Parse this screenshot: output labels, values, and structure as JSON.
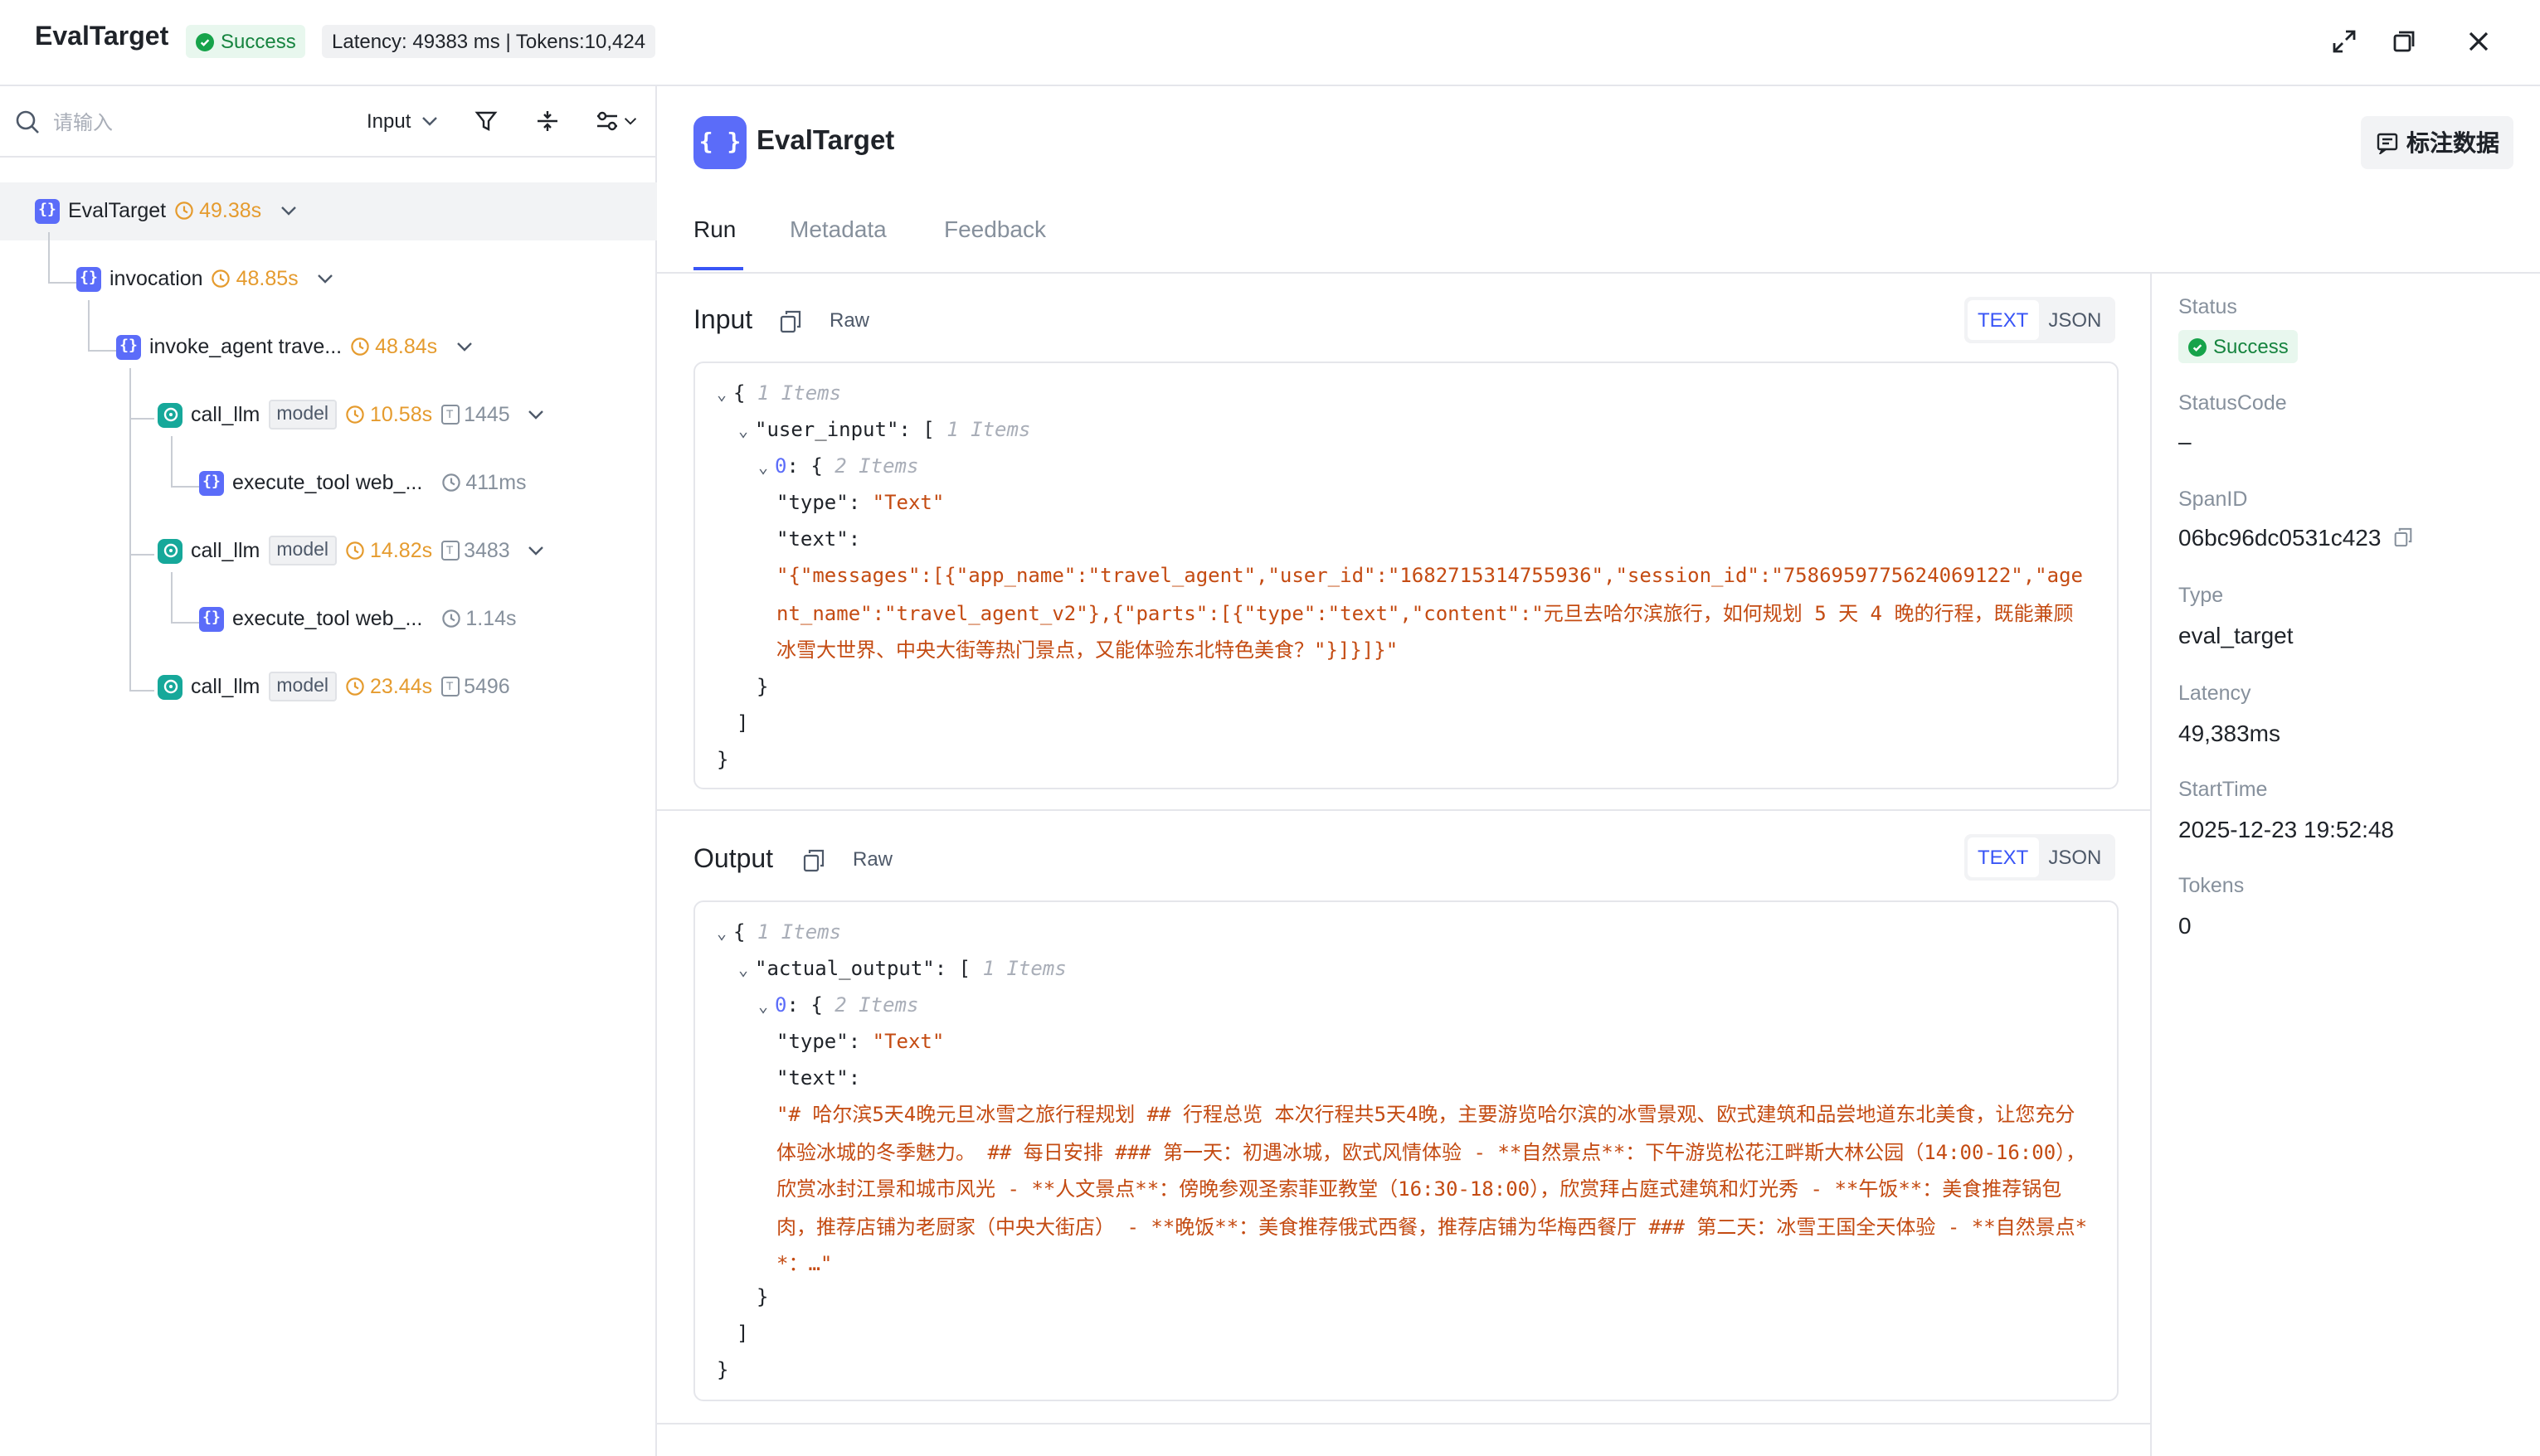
{
  "header": {
    "title": "EvalTarget",
    "status": "Success",
    "latency_tokens": "Latency: 49383 ms | Tokens:10,424"
  },
  "left": {
    "search_placeholder": "请输入",
    "filter_value": "Input",
    "tree": [
      {
        "label": "EvalTarget",
        "duration": "49.38s",
        "kind": "brace"
      },
      {
        "label": "invocation",
        "duration": "48.85s",
        "kind": "brace"
      },
      {
        "label": "invoke_agent trave...",
        "duration": "48.84s",
        "kind": "brace"
      },
      {
        "label": "call_llm",
        "tag": "model",
        "duration": "10.58s",
        "tokens": "1445",
        "kind": "llm"
      },
      {
        "label": "execute_tool web_...",
        "duration": "411ms",
        "kind": "brace"
      },
      {
        "label": "call_llm",
        "tag": "model",
        "duration": "14.82s",
        "tokens": "3483",
        "kind": "llm"
      },
      {
        "label": "execute_tool web_...",
        "duration": "1.14s",
        "kind": "brace"
      },
      {
        "label": "call_llm",
        "tag": "model",
        "duration": "23.44s",
        "tokens": "5496",
        "kind": "llm"
      }
    ]
  },
  "main": {
    "title": "EvalTarget",
    "annotate_button": "标注数据",
    "tabs": [
      "Run",
      "Metadata",
      "Feedback"
    ],
    "active_tab": "Run",
    "input": {
      "title": "Input",
      "raw": "Raw",
      "toggle": [
        "TEXT",
        "JSON"
      ],
      "root_meta": "1 Items",
      "key": "\"user_input\"",
      "key_meta": "1 Items",
      "item_meta": "2 Items",
      "type_key": "\"type\"",
      "type_val": "\"Text\"",
      "text_key": "\"text\"",
      "text_val": "\"{\"messages\":[{\"app_name\":\"travel_agent\",\"user_id\":\"1682715314755936\",\"session_id\":\"7586959775624069122\",\"agent_name\":\"travel_agent_v2\"},{\"parts\":[{\"type\":\"text\",\"content\":\"元旦去哈尔滨旅行，如何规划 5 天 4 晚的行程，既能兼顾冰雪大世界、中央大街等热门景点，又能体验东北特色美食？\"}]}]}\""
    },
    "output": {
      "title": "Output",
      "raw": "Raw",
      "toggle": [
        "TEXT",
        "JSON"
      ],
      "root_meta": "1 Items",
      "key": "\"actual_output\"",
      "key_meta": "1 Items",
      "item_meta": "2 Items",
      "type_key": "\"type\"",
      "type_val": "\"Text\"",
      "text_key": "\"text\"",
      "text_val": "\"# 哈尔滨5天4晚元旦冰雪之旅行程规划 ## 行程总览 本次行程共5天4晚，主要游览哈尔滨的冰雪景观、欧式建筑和品尝地道东北美食，让您充分体验冰城的冬季魅力。 ## 每日安排 ### 第一天：初遇冰城，欧式风情体验 - **自然景点**：下午游览松花江畔斯大林公园（14:00-16:00），欣赏冰封江景和城市风光 - **人文景点**：傍晚参观圣索菲亚教堂（16:30-18:00），欣赏拜占庭式建筑和灯光秀 - **午饭**：美食推荐锅包肉，推荐店铺为老厨家（中央大街店） - **晚饭**：美食推荐俄式西餐，推荐店铺为华梅西餐厅 ### 第二天：冰雪王国全天体验 - **自然景点**：…\""
    }
  },
  "panel": {
    "status_label": "Status",
    "status_value": "Success",
    "statuscode_label": "StatusCode",
    "statuscode_value": "–",
    "spanid_label": "SpanID",
    "spanid_value": "06bc96dc0531c423",
    "type_label": "Type",
    "type_value": "eval_target",
    "latency_label": "Latency",
    "latency_value": "49,383ms",
    "starttime_label": "StartTime",
    "starttime_value": "2025-12-23 19:52:48",
    "tokens_label": "Tokens",
    "tokens_value": "0"
  },
  "colors": {
    "accent": "#3955f6",
    "success": "#16a34a",
    "duration": "#e59b2e",
    "string": "#c44b12",
    "brace_icon": "#5b6cf9",
    "llm_icon": "#16a89a"
  },
  "icons": [
    "expand-icon",
    "restore-icon",
    "close-icon",
    "search-icon",
    "chevron-down-icon",
    "filter-icon",
    "collapse-icon",
    "settings-icon",
    "clock-icon",
    "token-icon",
    "copy-icon",
    "annotate-icon"
  ]
}
